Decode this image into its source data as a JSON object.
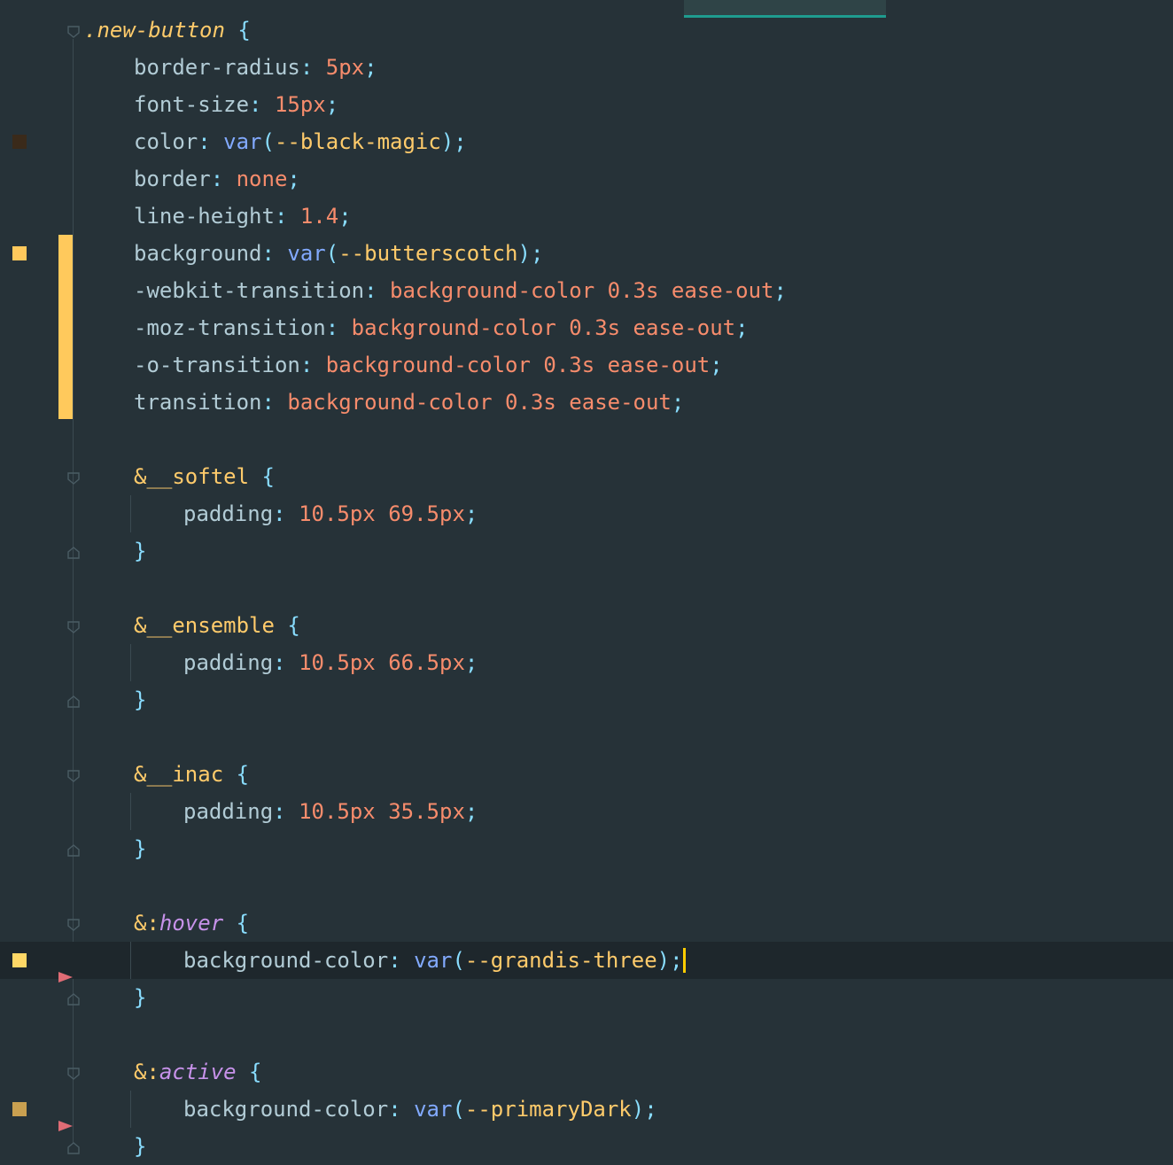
{
  "editor": {
    "language": "SCSS",
    "theme_colors": {
      "background": "#263238",
      "current_line": "#1e272c",
      "selector": "#ffcb6b",
      "property": "#b2ccd6",
      "value": "#f78c6c",
      "function": "#82aaff",
      "punctuation": "#89ddff",
      "pseudo": "#c792ea",
      "cursor": "#ffcc00",
      "modified_marker": "#ffc95c",
      "tab_accent": "#1e9c8f"
    },
    "current_line_index": 25,
    "lines": [
      {
        "indent": 0,
        "fold": "open",
        "tokens": [
          {
            "c": "t-sel",
            "t": ".new-button"
          },
          {
            "c": "t-brace",
            "t": " {"
          }
        ]
      },
      {
        "indent": 2,
        "tokens": [
          {
            "c": "t-prop",
            "t": "border-radius"
          },
          {
            "c": "t-punc",
            "t": ": "
          },
          {
            "c": "t-val",
            "t": "5px"
          },
          {
            "c": "t-punc",
            "t": ";"
          }
        ]
      },
      {
        "indent": 2,
        "tokens": [
          {
            "c": "t-prop",
            "t": "font-size"
          },
          {
            "c": "t-punc",
            "t": ": "
          },
          {
            "c": "t-val",
            "t": "15px"
          },
          {
            "c": "t-punc",
            "t": ";"
          }
        ]
      },
      {
        "indent": 2,
        "swatch": "#3a2a1a",
        "tokens": [
          {
            "c": "t-prop",
            "t": "color"
          },
          {
            "c": "t-punc",
            "t": ": "
          },
          {
            "c": "t-fn",
            "t": "var"
          },
          {
            "c": "t-punc",
            "t": "("
          },
          {
            "c": "t-var",
            "t": "--black-magic"
          },
          {
            "c": "t-punc",
            "t": ");"
          }
        ]
      },
      {
        "indent": 2,
        "tokens": [
          {
            "c": "t-prop",
            "t": "border"
          },
          {
            "c": "t-punc",
            "t": ": "
          },
          {
            "c": "t-val",
            "t": "none"
          },
          {
            "c": "t-punc",
            "t": ";"
          }
        ]
      },
      {
        "indent": 2,
        "tokens": [
          {
            "c": "t-prop",
            "t": "line-height"
          },
          {
            "c": "t-punc",
            "t": ": "
          },
          {
            "c": "t-val",
            "t": "1.4"
          },
          {
            "c": "t-punc",
            "t": ";"
          }
        ]
      },
      {
        "indent": 2,
        "swatch": "#ffc95c",
        "tokens": [
          {
            "c": "t-prop",
            "t": "background"
          },
          {
            "c": "t-punc",
            "t": ": "
          },
          {
            "c": "t-fn",
            "t": "var"
          },
          {
            "c": "t-punc",
            "t": "("
          },
          {
            "c": "t-var",
            "t": "--butterscotch"
          },
          {
            "c": "t-punc",
            "t": ");"
          }
        ]
      },
      {
        "indent": 2,
        "tokens": [
          {
            "c": "t-prop",
            "t": "-webkit-transition"
          },
          {
            "c": "t-punc",
            "t": ": "
          },
          {
            "c": "t-val",
            "t": "background-color 0.3s ease-out"
          },
          {
            "c": "t-punc",
            "t": ";"
          }
        ]
      },
      {
        "indent": 2,
        "tokens": [
          {
            "c": "t-prop",
            "t": "-moz-transition"
          },
          {
            "c": "t-punc",
            "t": ": "
          },
          {
            "c": "t-val",
            "t": "background-color 0.3s ease-out"
          },
          {
            "c": "t-punc",
            "t": ";"
          }
        ]
      },
      {
        "indent": 2,
        "tokens": [
          {
            "c": "t-prop",
            "t": "-o-transition"
          },
          {
            "c": "t-punc",
            "t": ": "
          },
          {
            "c": "t-val",
            "t": "background-color 0.3s ease-out"
          },
          {
            "c": "t-punc",
            "t": ";"
          }
        ]
      },
      {
        "indent": 2,
        "tokens": [
          {
            "c": "t-prop",
            "t": "transition"
          },
          {
            "c": "t-punc",
            "t": ": "
          },
          {
            "c": "t-val",
            "t": "background-color 0.3s ease-out"
          },
          {
            "c": "t-punc",
            "t": ";"
          }
        ]
      },
      {
        "indent": 0,
        "tokens": []
      },
      {
        "indent": 2,
        "fold": "open",
        "tokens": [
          {
            "c": "t-amp",
            "t": "&__softel"
          },
          {
            "c": "t-brace",
            "t": " {"
          }
        ]
      },
      {
        "indent": 4,
        "guide": true,
        "tokens": [
          {
            "c": "t-prop",
            "t": "padding"
          },
          {
            "c": "t-punc",
            "t": ": "
          },
          {
            "c": "t-val",
            "t": "10.5px 69.5px"
          },
          {
            "c": "t-punc",
            "t": ";"
          }
        ]
      },
      {
        "indent": 2,
        "fold": "close",
        "tokens": [
          {
            "c": "t-brace",
            "t": "}"
          }
        ]
      },
      {
        "indent": 0,
        "tokens": []
      },
      {
        "indent": 2,
        "fold": "open",
        "tokens": [
          {
            "c": "t-amp",
            "t": "&__ensemble"
          },
          {
            "c": "t-brace",
            "t": " {"
          }
        ]
      },
      {
        "indent": 4,
        "guide": true,
        "tokens": [
          {
            "c": "t-prop",
            "t": "padding"
          },
          {
            "c": "t-punc",
            "t": ": "
          },
          {
            "c": "t-val",
            "t": "10.5px 66.5px"
          },
          {
            "c": "t-punc",
            "t": ";"
          }
        ]
      },
      {
        "indent": 2,
        "fold": "close",
        "tokens": [
          {
            "c": "t-brace",
            "t": "}"
          }
        ]
      },
      {
        "indent": 0,
        "tokens": []
      },
      {
        "indent": 2,
        "fold": "open",
        "tokens": [
          {
            "c": "t-amp",
            "t": "&__inac"
          },
          {
            "c": "t-brace",
            "t": " {"
          }
        ]
      },
      {
        "indent": 4,
        "guide": true,
        "tokens": [
          {
            "c": "t-prop",
            "t": "padding"
          },
          {
            "c": "t-punc",
            "t": ": "
          },
          {
            "c": "t-val",
            "t": "10.5px 35.5px"
          },
          {
            "c": "t-punc",
            "t": ";"
          }
        ]
      },
      {
        "indent": 2,
        "fold": "close",
        "tokens": [
          {
            "c": "t-brace",
            "t": "}"
          }
        ]
      },
      {
        "indent": 0,
        "tokens": []
      },
      {
        "indent": 2,
        "fold": "open",
        "tokens": [
          {
            "c": "t-amp",
            "t": "&:"
          },
          {
            "c": "t-pseudo",
            "t": "hover"
          },
          {
            "c": "t-brace",
            "t": " {"
          }
        ]
      },
      {
        "indent": 4,
        "guide": true,
        "swatch": "#ffd866",
        "arrow": true,
        "cursor": true,
        "tokens": [
          {
            "c": "t-prop",
            "t": "background-color"
          },
          {
            "c": "t-punc",
            "t": ": "
          },
          {
            "c": "t-fn",
            "t": "var"
          },
          {
            "c": "t-punc",
            "t": "("
          },
          {
            "c": "t-var",
            "t": "--grandis-three"
          },
          {
            "c": "t-punc",
            "t": ");"
          }
        ]
      },
      {
        "indent": 2,
        "fold": "close",
        "tokens": [
          {
            "c": "t-brace",
            "t": "}"
          }
        ]
      },
      {
        "indent": 0,
        "tokens": []
      },
      {
        "indent": 2,
        "fold": "open",
        "tokens": [
          {
            "c": "t-amp",
            "t": "&:"
          },
          {
            "c": "t-pseudo",
            "t": "active"
          },
          {
            "c": "t-brace",
            "t": " {"
          }
        ]
      },
      {
        "indent": 4,
        "guide": true,
        "swatch": "#c9a050",
        "arrow": true,
        "tokens": [
          {
            "c": "t-prop",
            "t": "background-color"
          },
          {
            "c": "t-punc",
            "t": ": "
          },
          {
            "c": "t-fn",
            "t": "var"
          },
          {
            "c": "t-punc",
            "t": "("
          },
          {
            "c": "t-var",
            "t": "--primaryDark"
          },
          {
            "c": "t-punc",
            "t": ");"
          }
        ]
      },
      {
        "indent": 2,
        "fold": "close",
        "tokens": [
          {
            "c": "t-brace",
            "t": "}"
          }
        ]
      }
    ]
  }
}
